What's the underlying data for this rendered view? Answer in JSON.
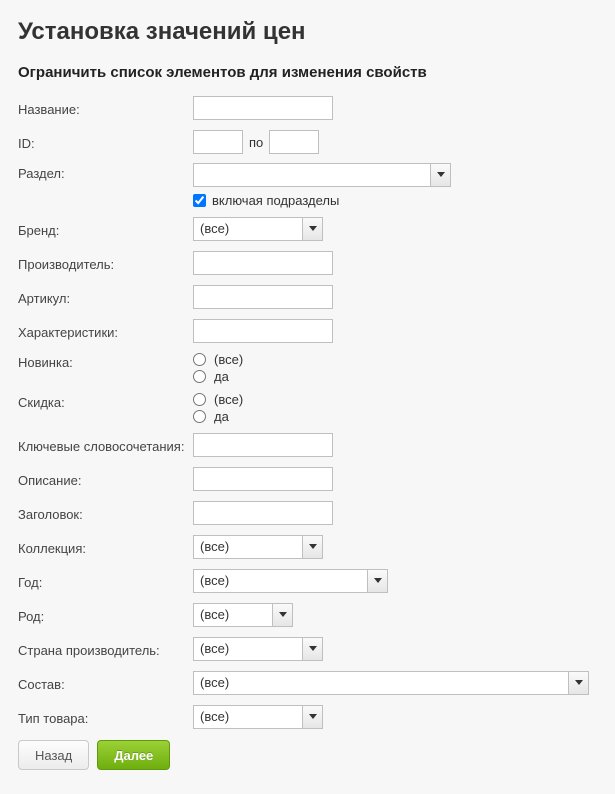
{
  "title": "Установка значений цен",
  "subtitle": "Ограничить список элементов для изменения свойств",
  "labels": {
    "name": "Название:",
    "id": "ID:",
    "id_sep": "по",
    "section": "Раздел:",
    "include_sub": "включая подразделы",
    "brand": "Бренд:",
    "producer": "Производитель:",
    "article": "Артикул:",
    "features": "Характеристики:",
    "new": "Новинка:",
    "discount": "Скидка:",
    "keywords": "Ключевые словосочетания:",
    "description": "Описание:",
    "heading": "Заголовок:",
    "collection": "Коллекция:",
    "year": "Год:",
    "gender": "Род:",
    "country": "Страна производитель:",
    "composition": "Состав:",
    "product_type": "Тип товара:"
  },
  "fields": {
    "name": "",
    "id_from": "",
    "id_to": "",
    "section": "",
    "include_sub_checked": true,
    "brand": "(все)",
    "producer": "",
    "article": "",
    "features": "",
    "keywords": "",
    "description": "",
    "heading": "",
    "collection": "(все)",
    "year": "(все)",
    "gender": "(все)",
    "country": "(все)",
    "composition": "(все)",
    "product_type": "(все)"
  },
  "radio": {
    "all": "(все)",
    "yes": "да"
  },
  "buttons": {
    "back": "Назад",
    "next": "Далее"
  }
}
